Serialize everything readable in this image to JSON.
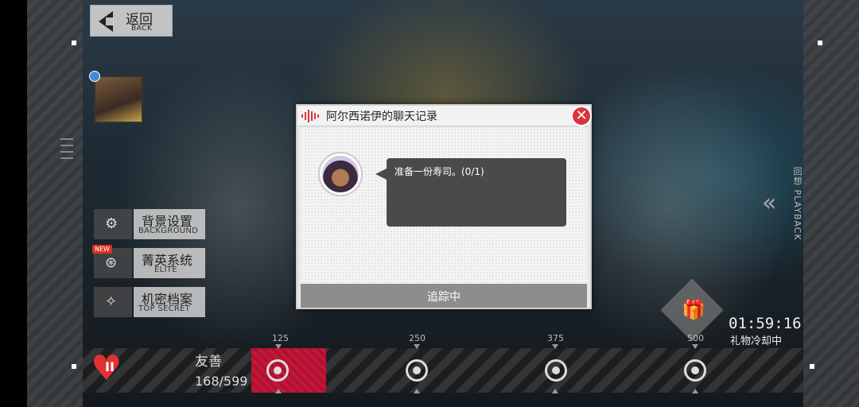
{
  "back_button": {
    "label": "返回",
    "sub_label": "BACK"
  },
  "menu": [
    {
      "label": "背景设置",
      "sub_label": "BACKGROUND",
      "icon": "gear-icon"
    },
    {
      "label": "菁英系统",
      "sub_label": "ELITE",
      "icon": "elite-icon",
      "badge": "NEW"
    },
    {
      "label": "机密档案",
      "sub_label": "TOP SECRET",
      "icon": "file-icon"
    }
  ],
  "playback": {
    "label": "回想 PLAYBACK"
  },
  "affection": {
    "level": "II",
    "label": "友善",
    "value": "168/599",
    "markers": [
      "125",
      "250",
      "375",
      "500"
    ]
  },
  "gift": {
    "timer": "01:59:16",
    "label": "礼物冷却中"
  },
  "dialog": {
    "title": "阿尔西诺伊的聊天记录",
    "message": "准备一份寿司。(0/1)",
    "footer": "追踪中"
  },
  "colors": {
    "accent_red": "#d8343b",
    "affection_bar": "#b21030"
  }
}
